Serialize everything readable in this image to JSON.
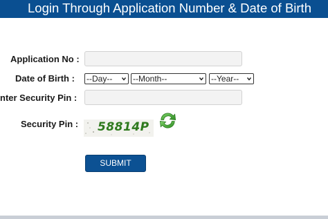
{
  "header": {
    "title": "Login Through Application Number & Date of Birth"
  },
  "form": {
    "application_no_label": "Application No :",
    "dob_label": "Date of Birth :",
    "day_select": "--Day--",
    "month_select": "--Month--",
    "year_select": "--Year--",
    "enter_pin_label": "nter Security Pin :",
    "security_pin_label": "Security Pin :",
    "captcha_text": "58814P",
    "submit_label": "SUBMIT"
  },
  "colors": {
    "header_bg": "#0a4f91",
    "submit_bg": "#0c5193",
    "captcha_text": "#2f7a1e",
    "refresh_icon": "#3a9d2b"
  },
  "icons": {
    "refresh": "refresh-icon",
    "dropdown": "chevron-down-icon"
  }
}
